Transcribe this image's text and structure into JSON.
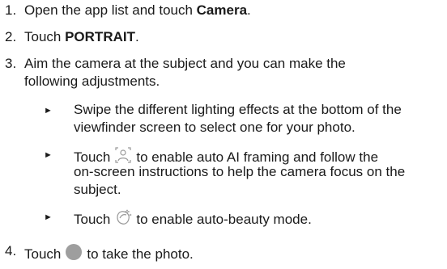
{
  "steps": [
    {
      "num": "1.",
      "pre": "Open the app list and touch ",
      "bold": "Camera",
      "post": "."
    },
    {
      "num": "2.",
      "pre": "Touch ",
      "bold": "PORTRAIT",
      "post": "."
    },
    {
      "num": "3.",
      "line1": "Aim the camera at the subject and you can make the",
      "line2": "following adjustments."
    },
    {
      "num": "4.",
      "pre": "Touch",
      "post": "to take the photo."
    }
  ],
  "bullets": [
    {
      "line1": "Swipe the different lighting effects at the bottom of the",
      "line2": "viewfinder screen to select one for your photo."
    },
    {
      "pre": "Touch",
      "post": "to enable auto AI framing and follow the",
      "line2": "on-screen instructions to help the camera focus on the",
      "line3": "subject."
    },
    {
      "pre": "Touch",
      "post": "to enable auto-beauty mode."
    }
  ],
  "icons": {
    "ai_framing": "ai-framing-icon",
    "beauty": "auto-beauty-icon",
    "shutter": "shutter-icon",
    "shutter_color": "#9e9e9e",
    "icon_stroke": "#9a9a9a"
  }
}
